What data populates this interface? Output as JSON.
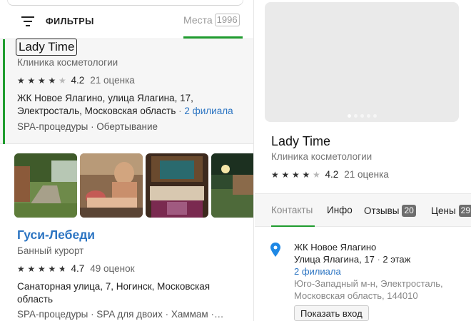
{
  "filter_bar": {
    "filter_label": "ФИЛЬТРЫ",
    "places_label": "Места",
    "places_count": "1996"
  },
  "results": [
    {
      "name": "Lady Time",
      "category": "Клиника косметологии",
      "rating": "4.2",
      "stars": 4,
      "reviews": "21 оценка",
      "address_line1": "ЖК Новое Ялагино, улица Ялагина, 17,",
      "address_line2": "Электросталь, Московская область",
      "separator": "·",
      "branches": "2 филиала",
      "tags": "SPA-процедуры · Обертывание"
    },
    {
      "name": "Гуси-Лебеди",
      "category": "Банный курорт",
      "rating": "4.7",
      "stars": 4.5,
      "reviews": "49 оценок",
      "address": "Санаторная улица, 7, Ногинск, Московская область",
      "tags": "SPA-процедуры · SPA для двоих · Хаммам ·…"
    }
  ],
  "details": {
    "name": "Lady Time",
    "category": "Клиника косметологии",
    "rating": "4.2",
    "stars": 4,
    "reviews": "21 оценка",
    "tabs": [
      {
        "label": "Контакты",
        "active": true
      },
      {
        "label": "Инфо"
      },
      {
        "label": "Отзывы",
        "badge": "20"
      },
      {
        "label": "Цены",
        "badge": "29"
      }
    ],
    "address": {
      "complex": "ЖК Новое Ялагино",
      "street": "Улица Ялагина, 17",
      "separator": "·",
      "floor": "2 этаж",
      "branches": "2 филиала",
      "district_line1": "Юго-Западный м-н, Электросталь,",
      "district_line2": "Московская область, 144010"
    },
    "entrance_button": "Показать вход"
  },
  "colors": {
    "accent_green": "#1f9c2e",
    "link_blue": "#2b74c2",
    "pin_blue": "#1e88e5"
  },
  "icons": {
    "filter": "filter-lines-icon",
    "pin": "location-pin-icon",
    "star": "star-icon"
  }
}
